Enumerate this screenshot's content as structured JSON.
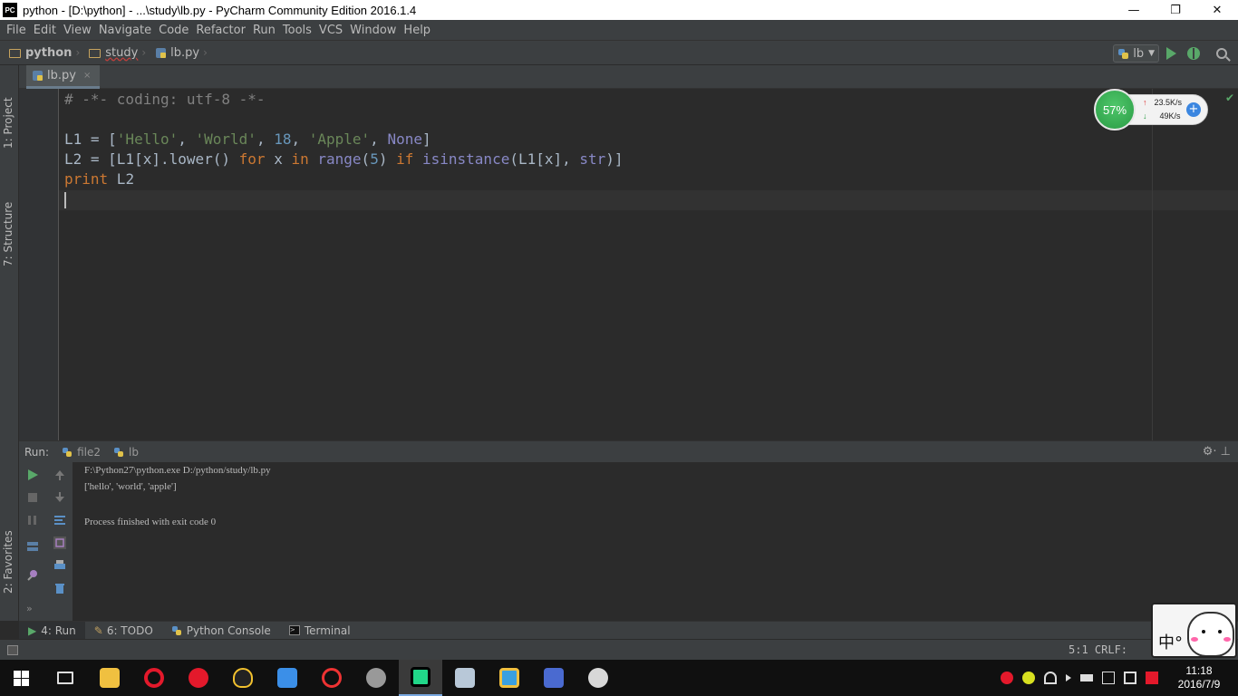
{
  "window": {
    "app_icon_text": "PC",
    "title": "python - [D:\\python] - ...\\study\\lb.py - PyCharm Community Edition 2016.1.4",
    "minimize": "—",
    "maximize": "❐",
    "close": "✕"
  },
  "menu": [
    "File",
    "Edit",
    "View",
    "Navigate",
    "Code",
    "Refactor",
    "Run",
    "Tools",
    "VCS",
    "Window",
    "Help"
  ],
  "breadcrumb": {
    "project": "python",
    "folder": "study",
    "file": "lb.py"
  },
  "run_config": {
    "name": "lb",
    "dropdown": "▼"
  },
  "left_tools": {
    "project": "1: Project",
    "structure": "7: Structure",
    "favorites": "2: Favorites"
  },
  "editor_tab": {
    "label": "lb.py",
    "close": "×"
  },
  "code_lines": [
    {
      "tokens": [
        {
          "t": "# -*- coding: utf-8 -*-",
          "c": "cm"
        }
      ]
    },
    {
      "tokens": []
    },
    {
      "tokens": [
        {
          "t": "L1 = [",
          "c": ""
        },
        {
          "t": "'Hello'",
          "c": "str"
        },
        {
          "t": ", ",
          "c": ""
        },
        {
          "t": "'World'",
          "c": "str"
        },
        {
          "t": ", ",
          "c": ""
        },
        {
          "t": "18",
          "c": "num"
        },
        {
          "t": ", ",
          "c": ""
        },
        {
          "t": "'Apple'",
          "c": "str"
        },
        {
          "t": ", ",
          "c": ""
        },
        {
          "t": "None",
          "c": "bi"
        },
        {
          "t": "]",
          "c": ""
        }
      ]
    },
    {
      "tokens": [
        {
          "t": "L2 = [L1[x].lower() ",
          "c": ""
        },
        {
          "t": "for",
          "c": "kw"
        },
        {
          "t": " x ",
          "c": ""
        },
        {
          "t": "in",
          "c": "kw"
        },
        {
          "t": " ",
          "c": ""
        },
        {
          "t": "range",
          "c": "bi"
        },
        {
          "t": "(",
          "c": ""
        },
        {
          "t": "5",
          "c": "num"
        },
        {
          "t": ") ",
          "c": ""
        },
        {
          "t": "if",
          "c": "kw"
        },
        {
          "t": " ",
          "c": ""
        },
        {
          "t": "isinstance",
          "c": "bi"
        },
        {
          "t": "(L1[x], ",
          "c": ""
        },
        {
          "t": "str",
          "c": "bi"
        },
        {
          "t": ")]",
          "c": ""
        }
      ]
    },
    {
      "tokens": [
        {
          "t": "print",
          "c": "kw"
        },
        {
          "t": " L2",
          "c": ""
        }
      ]
    }
  ],
  "net_widget": {
    "percent": "57%",
    "upload": "23.5K/s",
    "download": "49K/s",
    "up_arrow": "↑",
    "down_arrow": "↓",
    "plus": "+"
  },
  "run_panel": {
    "label": "Run:",
    "tabs": [
      "file2",
      "lb"
    ],
    "settings": "⚙·  ⊥"
  },
  "console": {
    "lines": [
      "F:\\Python27\\python.exe D:/python/study/lb.py",
      "['hello', 'world', 'apple']",
      "",
      "Process finished with exit code 0"
    ]
  },
  "bottom_tools": [
    {
      "label": "4: Run",
      "active": true
    },
    {
      "label": "6: TODO",
      "active": false
    },
    {
      "label": "Python Console",
      "active": false
    },
    {
      "label": "Terminal",
      "active": false
    }
  ],
  "status": {
    "position": "5:1  CRLF:"
  },
  "mascot": {
    "ime": "中°"
  },
  "clock": {
    "time": "11:18",
    "date": "2016/7/9"
  },
  "colors": {
    "accent_green": "#59a869",
    "editor_bg": "#2b2b2b",
    "panel_bg": "#3c3f41"
  }
}
